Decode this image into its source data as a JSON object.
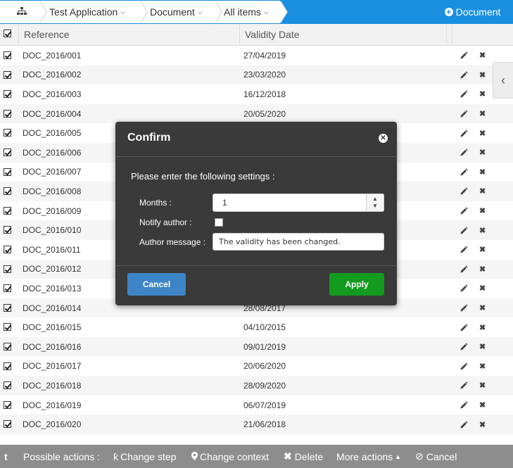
{
  "breadcrumb": {
    "home_icon": "sitemap-icon",
    "items": [
      "Test Application",
      "Document",
      "All items"
    ]
  },
  "header": {
    "new_document_label": "Document",
    "accent_color": "#1a8fe0"
  },
  "table": {
    "columns": [
      "Reference",
      "Validity Date"
    ],
    "rows": [
      {
        "reference": "DOC_2016/001",
        "validity": "27/04/2019",
        "checked": true
      },
      {
        "reference": "DOC_2016/002",
        "validity": "23/03/2020",
        "checked": true
      },
      {
        "reference": "DOC_2016/003",
        "validity": "16/12/2018",
        "checked": true
      },
      {
        "reference": "DOC_2016/004",
        "validity": "20/05/2020",
        "checked": true
      },
      {
        "reference": "DOC_2016/005",
        "validity": "",
        "checked": true
      },
      {
        "reference": "DOC_2016/006",
        "validity": "",
        "checked": true
      },
      {
        "reference": "DOC_2016/007",
        "validity": "",
        "checked": true
      },
      {
        "reference": "DOC_2016/008",
        "validity": "",
        "checked": true
      },
      {
        "reference": "DOC_2016/009",
        "validity": "",
        "checked": true
      },
      {
        "reference": "DOC_2016/010",
        "validity": "",
        "checked": true
      },
      {
        "reference": "DOC_2016/011",
        "validity": "",
        "checked": true
      },
      {
        "reference": "DOC_2016/012",
        "validity": "",
        "checked": true
      },
      {
        "reference": "DOC_2016/013",
        "validity": "",
        "checked": true
      },
      {
        "reference": "DOC_2016/014",
        "validity": "28/08/2017",
        "checked": true
      },
      {
        "reference": "DOC_2016/015",
        "validity": "04/10/2015",
        "checked": true
      },
      {
        "reference": "DOC_2016/016",
        "validity": "09/01/2019",
        "checked": true
      },
      {
        "reference": "DOC_2016/017",
        "validity": "20/06/2020",
        "checked": true
      },
      {
        "reference": "DOC_2016/018",
        "validity": "28/09/2020",
        "checked": true
      },
      {
        "reference": "DOC_2016/019",
        "validity": "06/07/2019",
        "checked": true
      },
      {
        "reference": "DOC_2016/020",
        "validity": "21/06/2018",
        "checked": true
      }
    ]
  },
  "dialog": {
    "title": "Confirm",
    "prompt": "Please enter the following settings :",
    "months_label": "Months :",
    "months_value": "1",
    "notify_label": "Notify author :",
    "notify_checked": false,
    "message_label": "Author message :",
    "message_value": "The validity has been changed.",
    "cancel_label": "Cancel",
    "apply_label": "Apply",
    "cancel_color": "#3d85c6",
    "apply_color": "#139b1f"
  },
  "bottombar": {
    "possible_actions": "Possible actions :",
    "change_step": "Change step",
    "change_context": "Change context",
    "delete": "Delete",
    "more_actions": "More actions",
    "cancel": "Cancel"
  }
}
